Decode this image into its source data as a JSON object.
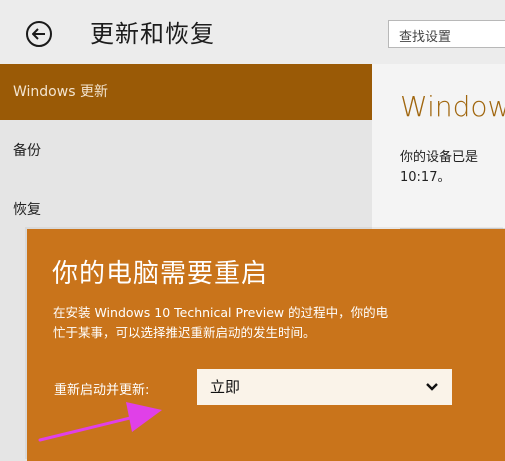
{
  "header": {
    "title": "更新和恢复",
    "search_placeholder": "查找设置"
  },
  "sidebar": {
    "items": [
      {
        "label": "Windows 更新"
      },
      {
        "label": "备份"
      },
      {
        "label": "恢复"
      }
    ]
  },
  "content": {
    "title": "Window",
    "status": "你的设备已是\n10:17。"
  },
  "dialog": {
    "title": "你的电脑需要重启",
    "message": "在安装 Windows 10 Technical Preview 的过程中，你的电\n忙于某事，可以选择推迟重新启动的发生时间。",
    "restart_label": "重新启动并更新:",
    "restart_selected": "立即"
  },
  "colors": {
    "accent_nav": "#9a5a06",
    "dialog_bg": "#c9741b",
    "annotation_arrow": "#e040e8"
  }
}
